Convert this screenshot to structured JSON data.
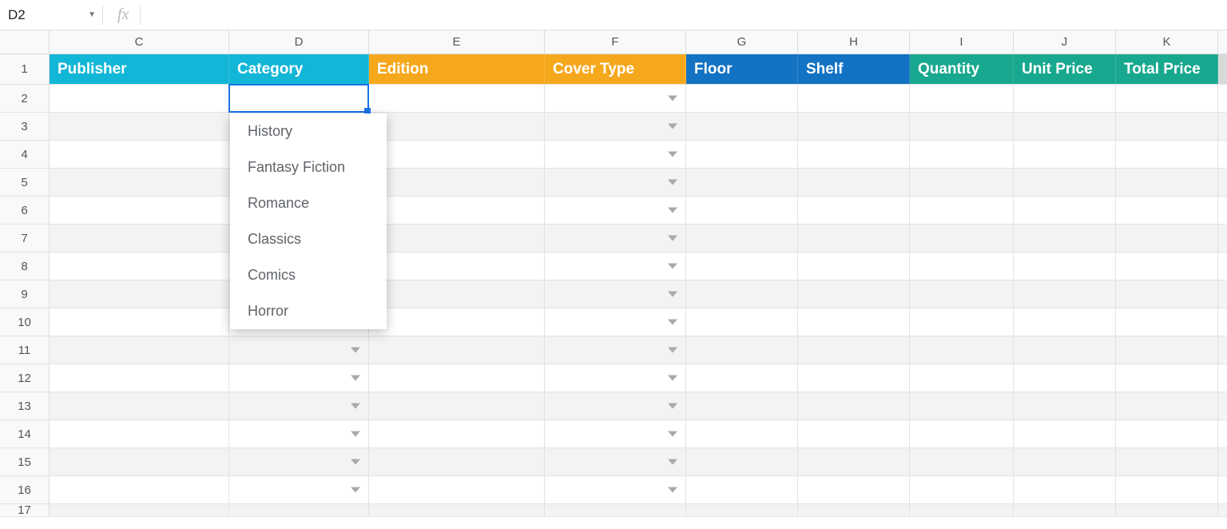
{
  "name_box": "D2",
  "fx_label": "fx",
  "columns": [
    "C",
    "D",
    "E",
    "F",
    "G",
    "H",
    "I",
    "J",
    "K"
  ],
  "headers": [
    {
      "col": "C",
      "label": "Publisher",
      "color": "hc1"
    },
    {
      "col": "D",
      "label": "Category",
      "color": "hc1"
    },
    {
      "col": "E",
      "label": "Edition",
      "color": "hc2"
    },
    {
      "col": "F",
      "label": "Cover Type",
      "color": "hc2"
    },
    {
      "col": "G",
      "label": "Floor",
      "color": "hc3"
    },
    {
      "col": "H",
      "label": "Shelf",
      "color": "hc3"
    },
    {
      "col": "I",
      "label": "Quantity",
      "color": "hc4"
    },
    {
      "col": "J",
      "label": "Unit Price",
      "color": "hc4"
    },
    {
      "col": "K",
      "label": "Total Price",
      "color": "hc4"
    }
  ],
  "row_numbers": [
    1,
    2,
    3,
    4,
    5,
    6,
    7,
    8,
    9,
    10,
    11,
    12,
    13,
    14,
    15,
    16,
    17
  ],
  "active_cell": "D2",
  "dropdown": {
    "anchor": "D2",
    "options": [
      "History",
      "Fantasy Fiction",
      "Romance",
      "Classics",
      "Comics",
      "Horror"
    ]
  },
  "caret_columns_until_row": [
    "D",
    "F"
  ],
  "caret_rows_d": [
    10,
    11,
    12,
    13,
    14,
    15,
    16
  ],
  "caret_rows_f": [
    2,
    3,
    4,
    5,
    6,
    7,
    8,
    9,
    10,
    11,
    12,
    13,
    14,
    15,
    16
  ],
  "colors": {
    "teal": "#12b6d6",
    "orange": "#f6a81c",
    "blue": "#1272c3",
    "green": "#18a88f",
    "selection": "#1a73e8"
  }
}
